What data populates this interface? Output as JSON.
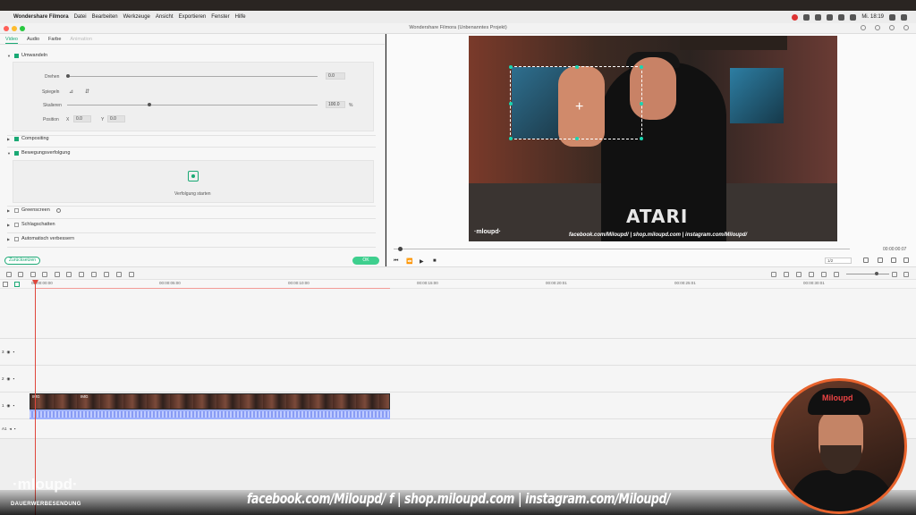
{
  "menubar": {
    "app_name": "Wondershare Filmora",
    "menus": [
      "Datei",
      "Bearbeiten",
      "Werkzeuge",
      "Ansicht",
      "Exportieren",
      "Fenster",
      "Hilfe"
    ],
    "clock": "Mi. 18:19"
  },
  "window": {
    "title": "Wondershare Filmora (Unbenanntes Projekt)"
  },
  "props": {
    "tabs": [
      "Video",
      "Audio",
      "Farbe",
      "Animation"
    ],
    "active_tab": "Video",
    "transform": {
      "title": "Umwandeln",
      "rotate_label": "Drehen",
      "rotate_value": "0.0",
      "flip_label": "Spiegeln",
      "scale_label": "Skalieren",
      "scale_value": "100.0",
      "scale_unit": "%",
      "scale_fraction": 0.33,
      "position_label": "Position",
      "x_label": "X",
      "x_value": "0.0",
      "y_label": "Y",
      "y_value": "0.0"
    },
    "compositing": "Compositing",
    "motion_tracking": "Bewegungsverfolgung",
    "start_tracking": "Verfolgung starten",
    "greenscreen": "Greenscreen",
    "drop_shadow": "Schlagschatten",
    "auto_enhance": "Automatisch verbessern",
    "reset_button": "Zurücksetzen",
    "ok_button": "OK"
  },
  "preview": {
    "timecode": "00:00:00:07",
    "zoom": "1/2",
    "playback_progress": 0.01,
    "video_logo": "·mloupd·",
    "video_social": "facebook.com/Miloupd/ | shop.miloupd.com | instagram.com/Miloupd/",
    "shirt_text": "ATARI"
  },
  "timeline": {
    "ruler": [
      "00:00:00:00",
      "00:00:05:00",
      "00:00:10:00",
      "00:00:15:00",
      "00:00:20:01",
      "00:00:25:01",
      "00:00:30:01"
    ],
    "tracks": [
      {
        "id": "3"
      },
      {
        "id": "2"
      },
      {
        "id": "1"
      },
      {
        "id": "A1"
      }
    ],
    "clip_label_1": "IMG",
    "clip_label_2": "IMG"
  },
  "overlay": {
    "banner": "facebook.com/Miloupd/  f  |  shop.miloupd.com  |  instagram.com/Miloupd/",
    "brand": "·mloupd·",
    "brand_sub": "DAUERWERBESENDUNG",
    "cam_cap_text": "Miloupd",
    "accent": "#19a974",
    "cam_ring": "#e8632d"
  }
}
